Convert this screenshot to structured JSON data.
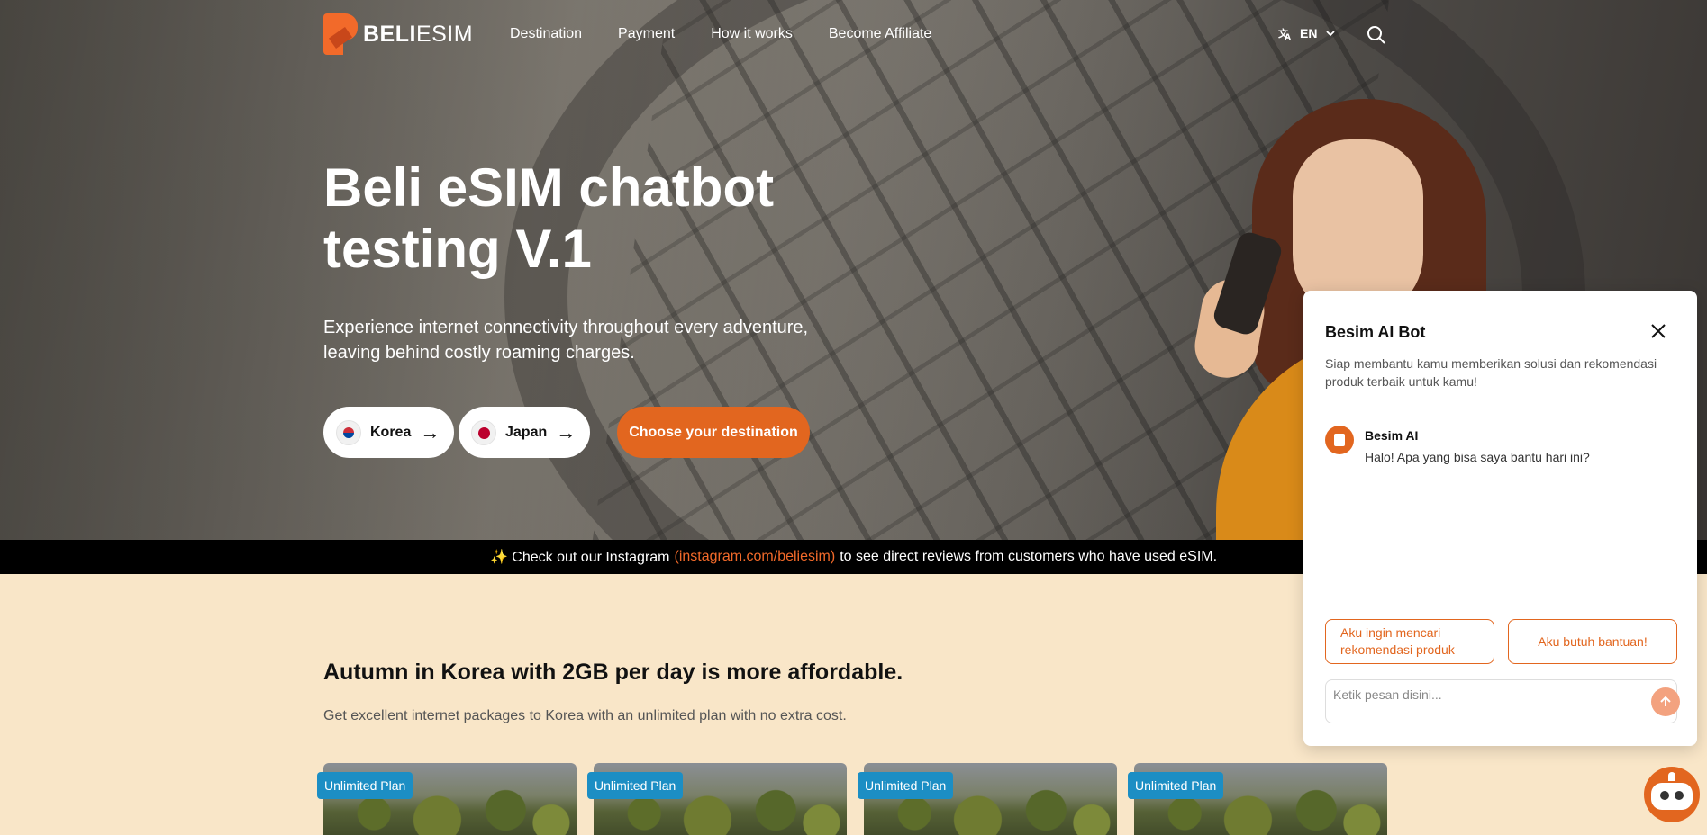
{
  "nav": {
    "logo_bold": "BELI",
    "logo_light": "ESIM",
    "links": [
      "Destination",
      "Payment",
      "How it works",
      "Become Affiliate"
    ],
    "lang": "EN"
  },
  "hero": {
    "title": "Beli eSIM chatbot testing V.1",
    "subtitle": "Experience internet connectivity throughout every adventure, leaving behind costly roaming charges.",
    "chips": [
      "Korea",
      "Japan"
    ],
    "cta": "Choose your destination"
  },
  "banner": {
    "prefix": "✨ Check out our Instagram",
    "link": "(instagram.com/beliesim)",
    "suffix": "to see direct reviews from customers who have used eSIM."
  },
  "section": {
    "title": "Autumn in Korea with 2GB per day is more affordable.",
    "subtitle": "Get excellent internet packages to Korea with an unlimited plan with no extra cost.",
    "badges": [
      "Unlimited Plan",
      "Unlimited Plan",
      "Unlimited Plan",
      "Unlimited Plan"
    ]
  },
  "chat": {
    "title": "Besim AI Bot",
    "description": "Siap membantu kamu memberikan solusi dan rekomendasi produk terbaik untuk kamu!",
    "bot_name": "Besim AI",
    "bot_message": "Halo! Apa yang bisa saya bantu hari ini?",
    "quick_replies": [
      "Aku ingin mencari rekomendasi produk",
      "Aku butuh bantuan!"
    ],
    "input_placeholder": "Ketik pesan disini..."
  },
  "colors": {
    "accent": "#e2661f",
    "badge": "#1c8ec4",
    "section_bg": "#f9e6c8"
  }
}
